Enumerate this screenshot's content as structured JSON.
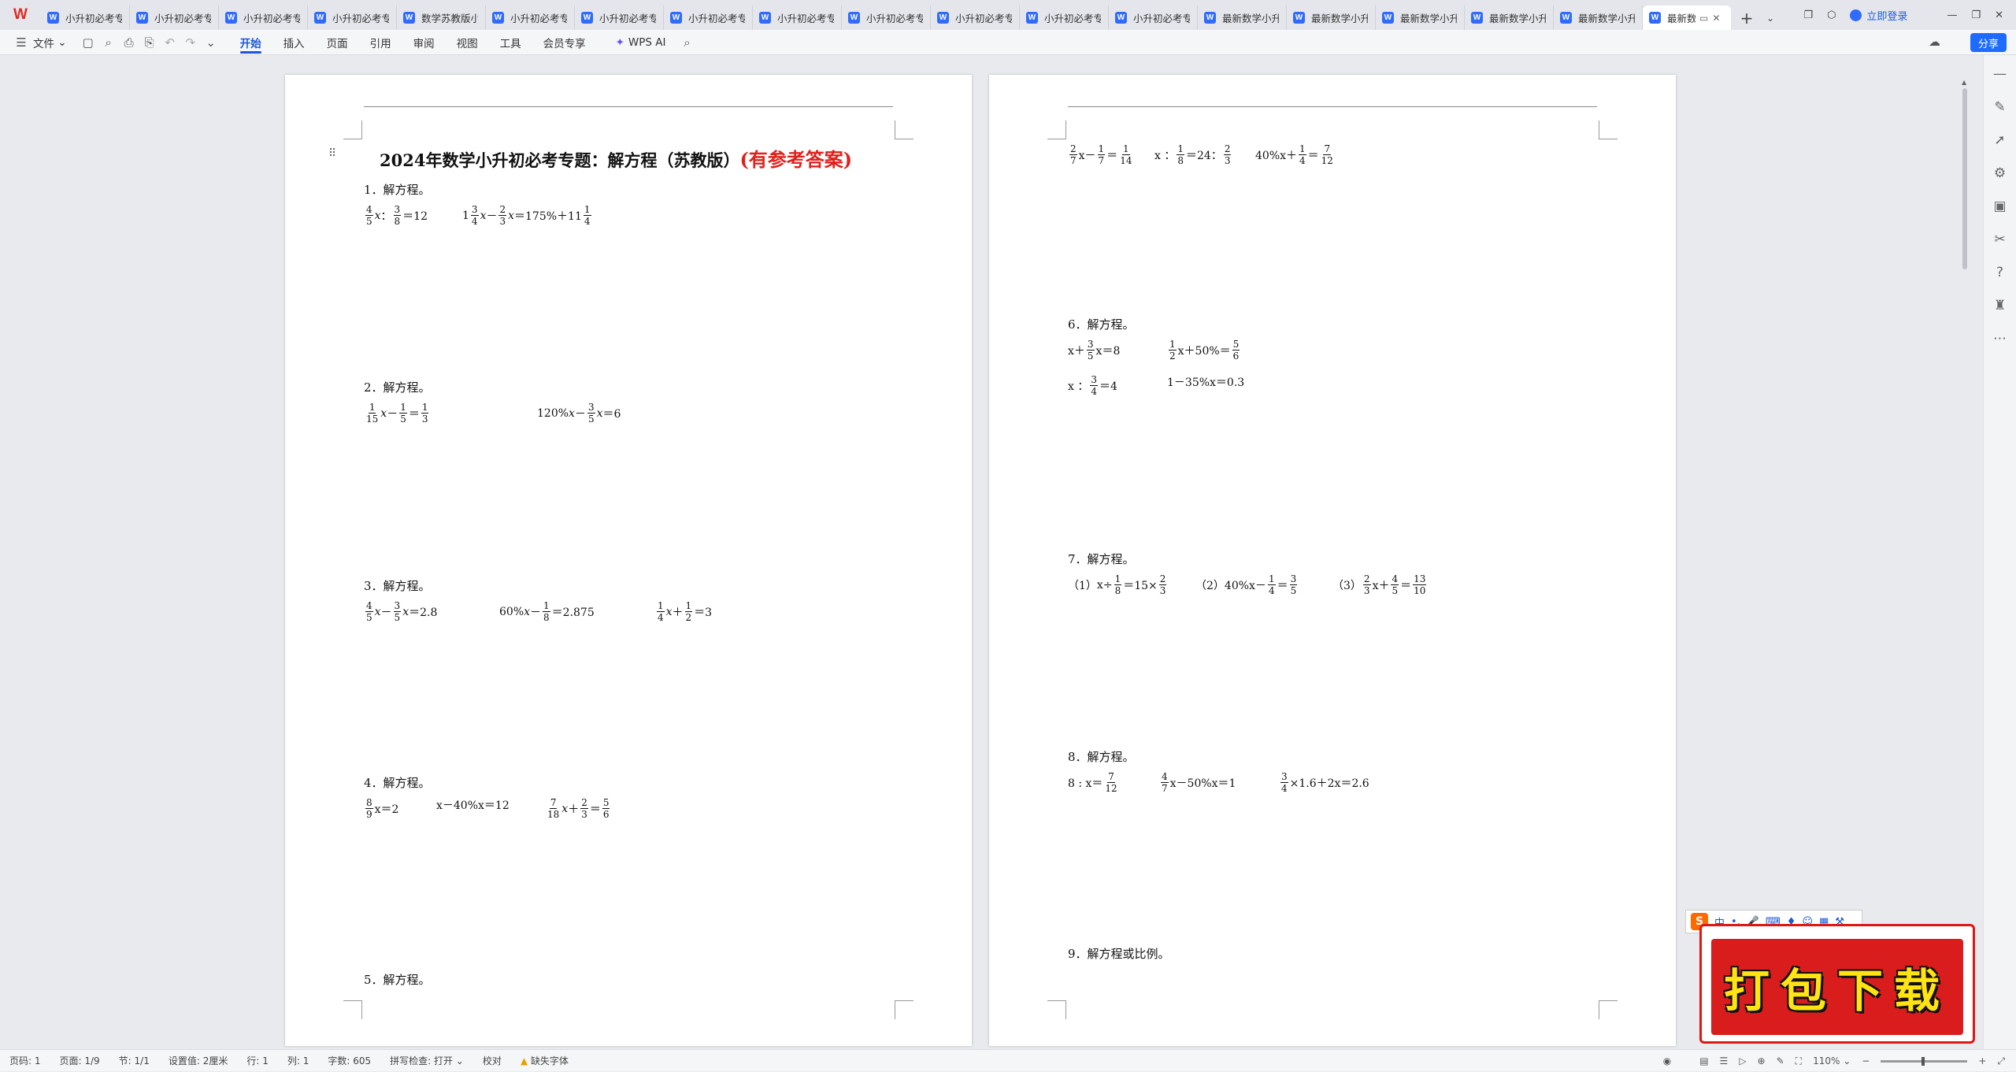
{
  "tabs": [
    {
      "label": "小升初必考专题"
    },
    {
      "label": "小升初必考专题"
    },
    {
      "label": "小升初必考专题"
    },
    {
      "label": "小升初必考专题"
    },
    {
      "label": "数学苏教版小升初"
    },
    {
      "label": "小升初必考专题"
    },
    {
      "label": "小升初必考专题"
    },
    {
      "label": "小升初必考专题"
    },
    {
      "label": "小升初必考专题"
    },
    {
      "label": "小升初必考专题"
    },
    {
      "label": "小升初必考专题"
    },
    {
      "label": "小升初必考专题"
    },
    {
      "label": "小升初必考专题"
    },
    {
      "label": "最新数学小升初"
    },
    {
      "label": "最新数学小升初"
    },
    {
      "label": "最新数学小升初"
    },
    {
      "label": "最新数学小升初"
    },
    {
      "label": "最新数学小升初"
    }
  ],
  "active_tab": {
    "label": "最新数学"
  },
  "window": {
    "login": "立即登录",
    "share": "分享"
  },
  "menu": {
    "file": "文件",
    "items": [
      "开始",
      "插入",
      "页面",
      "引用",
      "审阅",
      "视图",
      "工具",
      "会员专享"
    ],
    "wps_ai": "WPS AI"
  },
  "doc": {
    "title": "2024年数学小升初必考专题：解方程（苏教版）",
    "title_red": "(有参考答案)",
    "q1": "1．解方程。",
    "q2": "2．解方程。",
    "q3": "3．解方程。",
    "q4": "4．解方程。",
    "q5": "5．解方程。",
    "q6": "6．解方程。",
    "q7": "7．解方程。",
    "q8": "8．解方程。",
    "q9": "9．解方程或比例。",
    "q7a": "（1）",
    "q7b": "（2）",
    "q7c": "（3）"
  },
  "status": {
    "page_code": "页码: 1",
    "page": "页面: 1/9",
    "section": "节: 1/1",
    "setting": "设置值: 2厘米",
    "row": "行: 1",
    "col": "列: 1",
    "words": "字数: 605",
    "spell": "拼写检查: 打开",
    "proof": "校对",
    "font_warn": "缺失字体",
    "zoom": "110%"
  },
  "ime": {
    "label": "中"
  },
  "promo": {
    "text": "打包下载"
  },
  "colors": {
    "accent": "#1a56d6",
    "title_red": "#e0201b",
    "promo_red": "#d91d1d",
    "promo_yellow": "#ffe312"
  }
}
